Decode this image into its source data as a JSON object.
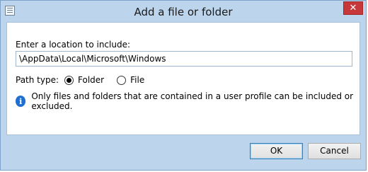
{
  "window": {
    "title": "Add a file or folder",
    "close_label": "✕"
  },
  "form": {
    "prompt_label": "Enter a location to include:",
    "path_value": "\\AppData\\Local\\Microsoft\\Windows",
    "path_type_label": "Path type:",
    "options": [
      {
        "label": "Folder",
        "checked": true
      },
      {
        "label": "File",
        "checked": false
      }
    ],
    "info_icon_glyph": "i",
    "info_text": "Only files and folders that are contained in a user profile can be included or excluded."
  },
  "buttons": {
    "ok_label": "OK",
    "cancel_label": "Cancel"
  },
  "colors": {
    "frame": "#bcd4ec",
    "close": "#c7383a",
    "info": "#1f6fd1"
  }
}
